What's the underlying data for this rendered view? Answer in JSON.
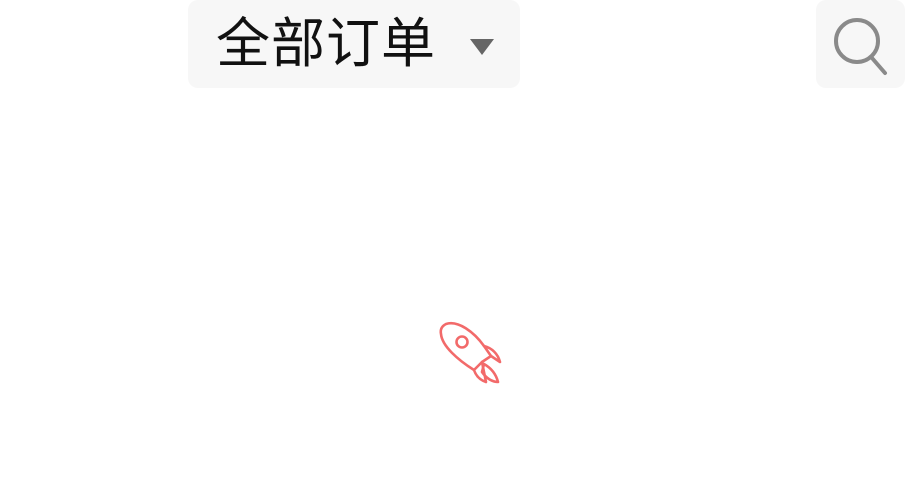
{
  "header": {
    "order_filter": {
      "label": "全部订单",
      "caret_icon": "caret-down-icon"
    },
    "search": {
      "icon": "search-icon"
    }
  },
  "main": {
    "loading_icon": "rocket-icon",
    "accent_color": "#f26a6a"
  },
  "colors": {
    "background": "#ffffff",
    "control_background": "#f7f7f7",
    "text": "#111111",
    "icon_gray": "#8a8a8a",
    "caret": "#666666"
  }
}
